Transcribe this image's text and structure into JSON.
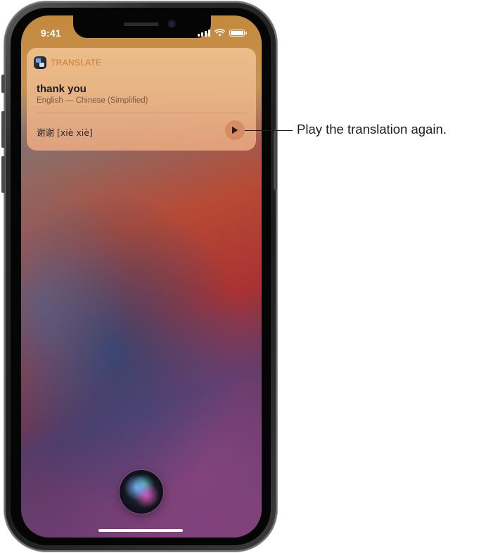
{
  "status_bar": {
    "time": "9:41",
    "icons": [
      "cellular-signal-icon",
      "wifi-icon",
      "battery-icon"
    ]
  },
  "translate_card": {
    "app_name": "TRANSLATE",
    "app_icon": "translate-app-icon",
    "phrase": "thank you",
    "languages": "English — Chinese (Simplified)",
    "translation": "谢谢 [xiè xiè]",
    "play_icon": "play-icon"
  },
  "siri": {
    "icon": "siri-orb-icon"
  },
  "callout": {
    "text": "Play the translation again."
  },
  "colors": {
    "card_accent": "#d07a2a",
    "card_background": "#ecb48e",
    "callout_text": "#1d1d1d"
  }
}
